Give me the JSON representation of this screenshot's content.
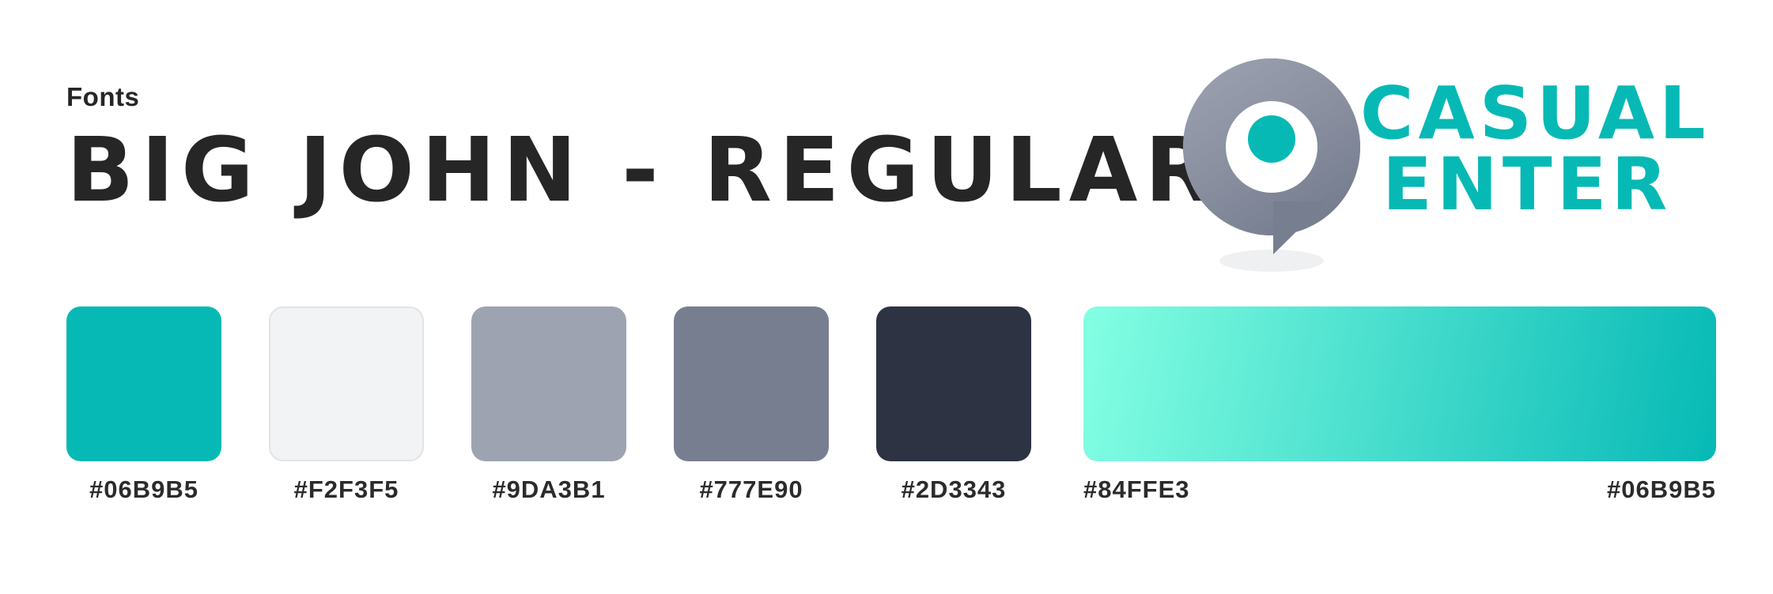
{
  "fonts": {
    "label": "Fonts",
    "name": "BIG JOHN - REGULAR"
  },
  "logo": {
    "line1": "CASUAL",
    "line2": "ENTER",
    "icon": "location-pin-c-icon"
  },
  "palette": [
    {
      "hex": "#06B9B5",
      "color": "#06B9B5"
    },
    {
      "hex": "#F2F3F5",
      "color": "#F2F3F5"
    },
    {
      "hex": "#9DA3B1",
      "color": "#9DA3B1"
    },
    {
      "hex": "#777E90",
      "color": "#777E90"
    },
    {
      "hex": "#2D3343",
      "color": "#2D3343"
    }
  ],
  "gradient": {
    "start": "#84FFE3",
    "end": "#06B9B5"
  }
}
